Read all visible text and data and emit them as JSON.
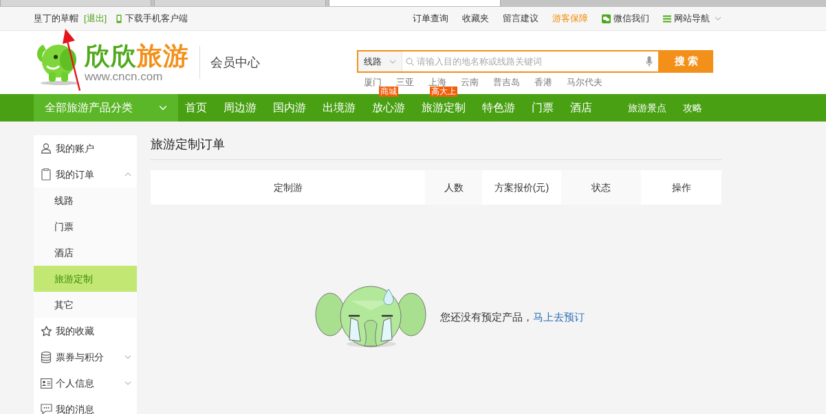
{
  "browser_tabs": [
    {
      "selected": false
    },
    {
      "selected": false
    },
    {
      "selected": true
    }
  ],
  "topbar": {
    "user": "垦丁的草帽",
    "logout": "[退出]",
    "app_download": "下载手机客户端",
    "links": [
      {
        "label": "订单查询",
        "highlight": false,
        "kind": "plain"
      },
      {
        "label": "收藏夹",
        "highlight": false,
        "kind": "plain"
      },
      {
        "label": "留言建议",
        "highlight": false,
        "kind": "plain"
      },
      {
        "label": "游客保障",
        "highlight": true,
        "kind": "plain"
      },
      {
        "label": "微信我们",
        "highlight": false,
        "kind": "wechat"
      },
      {
        "label": "网站导航",
        "highlight": false,
        "kind": "sitemap"
      }
    ]
  },
  "header": {
    "wordmark": [
      "欣欣",
      "旅游"
    ],
    "url": "www.cncn.com",
    "subtitle": "会员中心",
    "search": {
      "category": "线路",
      "placeholder": "请输入目的地名称或线路关键词",
      "button": "搜 索"
    },
    "hot_words": [
      "厦门",
      "三亚",
      "上海",
      "云南",
      "普吉岛",
      "香港",
      "马尔代夫"
    ]
  },
  "nav": {
    "category": "全部旅游产品分类",
    "items": [
      {
        "label": "首页",
        "kind": "main"
      },
      {
        "label": "周边游",
        "kind": "main"
      },
      {
        "label": "国内游",
        "kind": "main"
      },
      {
        "label": "出境游",
        "kind": "main"
      },
      {
        "label": "放心游",
        "kind": "main",
        "badge": "商城"
      },
      {
        "label": "旅游定制",
        "kind": "main",
        "badge": "高大上"
      },
      {
        "label": "特色游",
        "kind": "main"
      },
      {
        "label": "门票",
        "kind": "main"
      },
      {
        "label": "酒店",
        "kind": "main"
      },
      {
        "label": "旅游景点",
        "kind": "secondary"
      },
      {
        "label": "攻略",
        "kind": "secondary"
      }
    ]
  },
  "sidebar": {
    "items": [
      {
        "kind": "link",
        "label": "我的账户"
      },
      {
        "kind": "group",
        "label": "我的订单",
        "expanded": true,
        "children": [
          {
            "label": "线路",
            "selected": false
          },
          {
            "label": "门票",
            "selected": false
          },
          {
            "label": "酒店",
            "selected": false
          },
          {
            "label": "旅游定制",
            "selected": true
          },
          {
            "label": "其它",
            "selected": false
          }
        ]
      },
      {
        "kind": "link",
        "label": "我的收藏"
      },
      {
        "kind": "group",
        "label": "票券与积分",
        "expanded": false
      },
      {
        "kind": "group",
        "label": "个人信息",
        "expanded": false
      },
      {
        "kind": "link",
        "label": "我的消息"
      }
    ]
  },
  "main": {
    "title": "旅游定制订单",
    "table": {
      "columns": [
        "定制游",
        "人数",
        "方案报价(元)",
        "状态",
        "操作"
      ]
    },
    "empty": {
      "message": "您还没有预定产品，",
      "link": "马上去预订"
    }
  }
}
